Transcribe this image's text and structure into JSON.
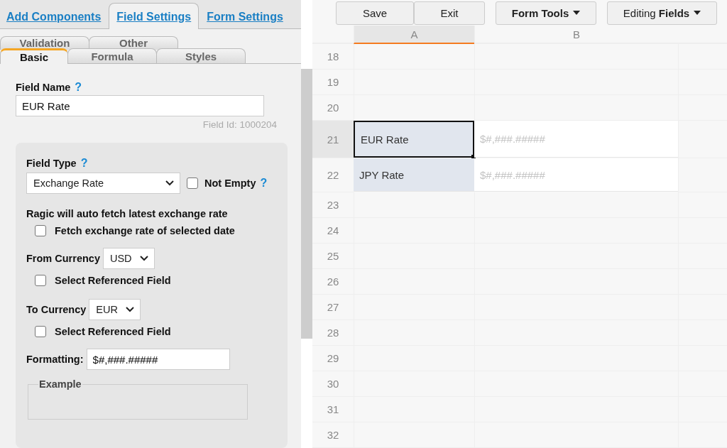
{
  "top_tabs": [
    {
      "label": "Add Components",
      "selected": false
    },
    {
      "label": "Field Settings",
      "selected": true
    },
    {
      "label": "Form Settings",
      "selected": false
    }
  ],
  "sub_tabs": [
    [
      {
        "label": "Validation",
        "selected": false
      },
      {
        "label": "Other",
        "selected": false
      }
    ],
    [
      {
        "label": "Basic",
        "selected": true
      },
      {
        "label": "Formula",
        "selected": false
      },
      {
        "label": "Styles",
        "selected": false
      }
    ]
  ],
  "field_name": {
    "label": "Field Name",
    "help": "?",
    "value": "EUR Rate",
    "field_id": "Field Id: 1000204"
  },
  "field_type": {
    "label": "Field Type",
    "help": "?",
    "value": "Exchange Rate",
    "not_empty": {
      "label": "Not Empty",
      "help": "?",
      "checked": false
    }
  },
  "auto_fetch_note": "Ragic will auto fetch latest exchange rate",
  "fetch_selected_date": {
    "label": "Fetch exchange rate of selected date",
    "checked": false
  },
  "currencies": [
    {
      "label": "From Currency",
      "value": "USD",
      "referenced": {
        "label": "Select Referenced Field",
        "checked": false
      }
    },
    {
      "label": "To Currency",
      "value": "EUR",
      "referenced": {
        "label": "Select Referenced Field",
        "checked": false
      }
    }
  ],
  "formatting": {
    "label": "Formatting:",
    "value": "$#,###.#####"
  },
  "example": {
    "legend": "Example"
  },
  "toolbar": [
    {
      "label": "Save",
      "kind": "plain"
    },
    {
      "label": "Exit",
      "kind": "plain"
    },
    {
      "label": "Form Tools",
      "kind": "menu"
    },
    {
      "label": "Editing **Fields**",
      "kind": "menu"
    }
  ],
  "sheet": {
    "columns": [
      {
        "label": "A",
        "selected": true
      },
      {
        "label": "B",
        "selected": false
      }
    ],
    "rows": [
      {
        "number": "18",
        "selected": false
      },
      {
        "number": "19",
        "selected": false
      },
      {
        "number": "20",
        "selected": false
      },
      {
        "number": "21",
        "selected": true,
        "cells": [
          {
            "text": "EUR Rate",
            "kind": "label",
            "active": true
          },
          {
            "text": "$#,###.#####",
            "kind": "format",
            "active": false
          }
        ]
      },
      {
        "number": "22",
        "selected": false,
        "cells": [
          {
            "text": "JPY Rate",
            "kind": "label",
            "active": false
          },
          {
            "text": "$#,###.#####",
            "kind": "format",
            "active": false
          }
        ]
      },
      {
        "number": "23",
        "selected": false
      },
      {
        "number": "24",
        "selected": false
      },
      {
        "number": "25",
        "selected": false
      },
      {
        "number": "26",
        "selected": false
      },
      {
        "number": "27",
        "selected": false
      },
      {
        "number": "28",
        "selected": false
      },
      {
        "number": "29",
        "selected": false
      },
      {
        "number": "30",
        "selected": false
      },
      {
        "number": "31",
        "selected": false
      },
      {
        "number": "32",
        "selected": false
      }
    ]
  }
}
